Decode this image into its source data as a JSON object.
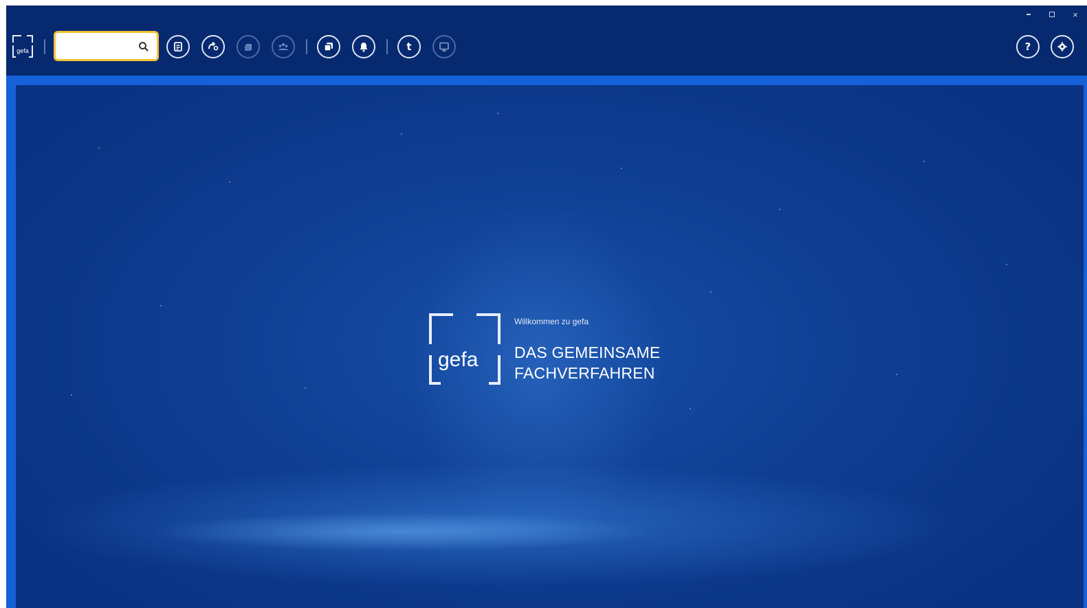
{
  "app": {
    "logo_text": "gefa",
    "search": {
      "value": "",
      "placeholder": ""
    },
    "window_controls": {
      "minimize": "–",
      "maximize": "□",
      "close": "×"
    }
  },
  "toolbar": {
    "buttons": [
      {
        "icon": "document-icon"
      },
      {
        "icon": "transfer-icon"
      },
      {
        "icon": "stack-icon"
      },
      {
        "icon": "group-icon"
      },
      {
        "icon": "copy-icon"
      },
      {
        "icon": "bell-icon"
      },
      {
        "icon": "tasks-icon",
        "glyph": "t"
      },
      {
        "icon": "monitor-icon"
      },
      {
        "icon": "help-icon",
        "glyph": "?"
      },
      {
        "icon": "settings-icon"
      }
    ]
  },
  "splash": {
    "logo_word": "gefa",
    "welcome": "Willkommen zu gefa",
    "tagline_line1": "DAS GEMEINSAME",
    "tagline_line2": "FACHVERFAHREN"
  }
}
